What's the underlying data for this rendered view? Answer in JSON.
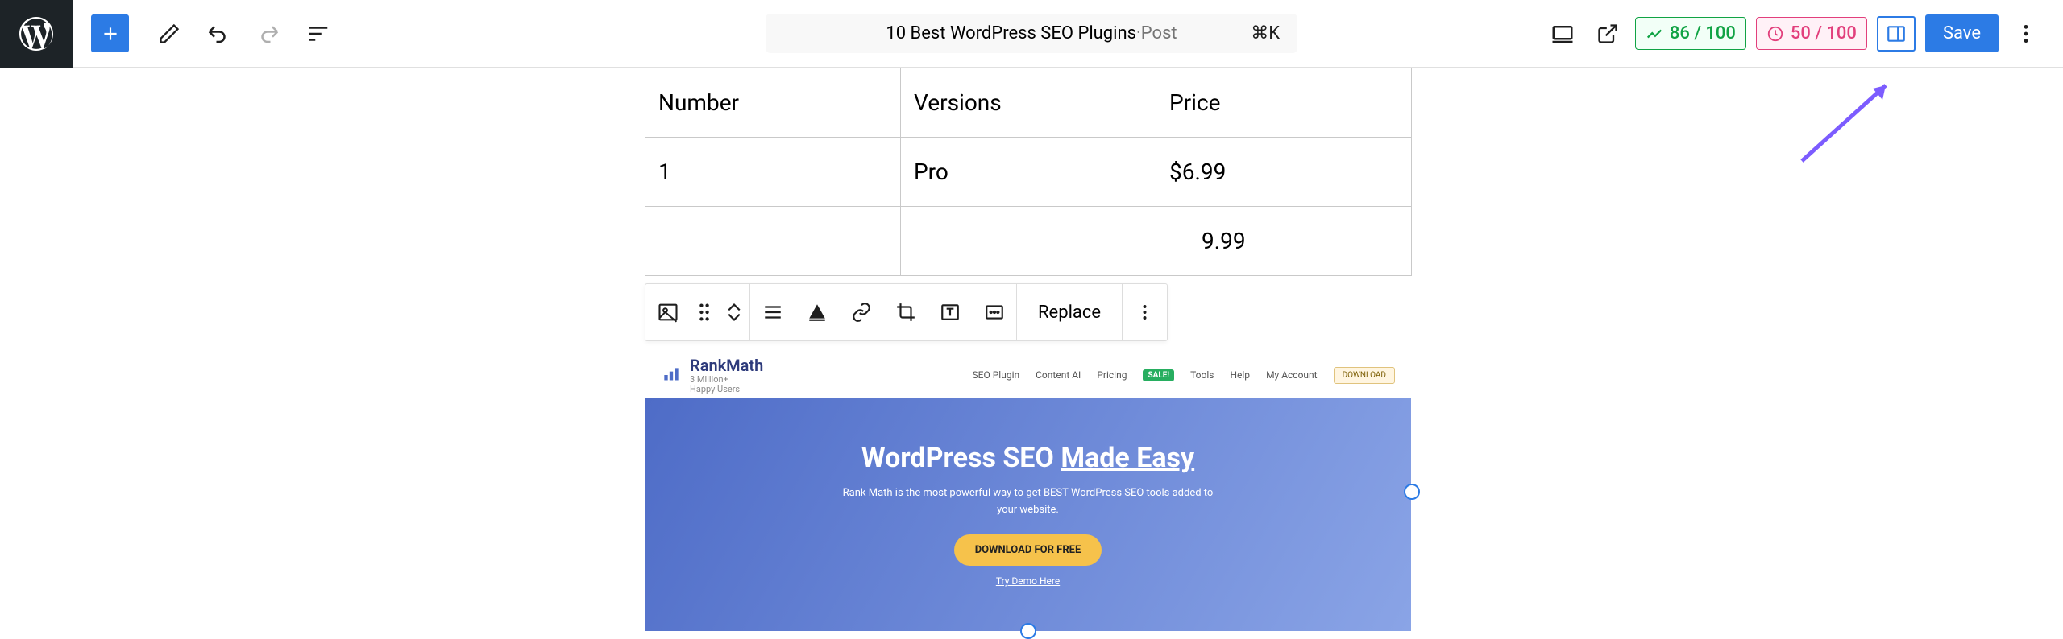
{
  "topbar": {
    "title_main": "10 Best WordPress SEO Plugins",
    "title_sep": " · ",
    "title_type": "Post",
    "kbd_shortcut": "⌘K",
    "metric_green": "86 / 100",
    "metric_pink": "50 / 100",
    "save_label": "Save"
  },
  "table": {
    "headers": [
      "Number",
      "Versions",
      "Price"
    ],
    "rows": [
      [
        "1",
        "Pro",
        "$6.99"
      ],
      [
        "",
        "",
        "9.99"
      ]
    ]
  },
  "block_toolbar": {
    "replace_label": "Replace"
  },
  "hero": {
    "brand_name": "RankMath",
    "brand_sub1": "3 Million+",
    "brand_sub2": "Happy Users",
    "nav": {
      "seo_plugin": "SEO Plugin",
      "content_ai": "Content AI",
      "pricing": "Pricing",
      "sale": "SALE!",
      "tools": "Tools",
      "help": "Help",
      "account": "My Account",
      "download": "DOWNLOAD"
    },
    "headline_prefix": "WordPress SEO ",
    "headline_underlined": "Made Easy",
    "subhead": "Rank Math is the most powerful way to get BEST WordPress SEO tools added to your website.",
    "cta": "DOWNLOAD FOR FREE",
    "demo": "Try Demo Here"
  }
}
